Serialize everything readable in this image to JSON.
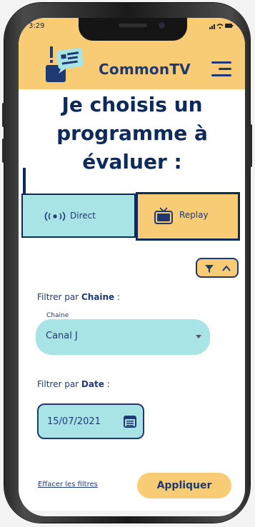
{
  "status": {
    "time": "3:29",
    "icons": "▐ ≡ ▬"
  },
  "header": {
    "brand": "CommonTV",
    "logo_icon": "speech-bubble-logo",
    "menu_icon": "hamburger-icon"
  },
  "title": {
    "line1": "Je choisis un",
    "line2": "programme à",
    "line3": "évaluer :"
  },
  "tabs": [
    {
      "label": "Direct",
      "icon": "broadcast-icon",
      "selected": false
    },
    {
      "label": "Replay",
      "icon": "tv-icon",
      "selected": true
    }
  ],
  "filters": {
    "toggle_icons": [
      "filter-icon",
      "chevron-up-icon"
    ],
    "channel": {
      "label_prefix": "Filtrer par ",
      "label_bold": "Chaine",
      "label_suffix": " :",
      "small_label": "Chaine",
      "value": "Canal J"
    },
    "date": {
      "label_prefix": "Filtrer par ",
      "label_bold": "Date",
      "label_suffix": " :",
      "value": "15/07/2021",
      "icon": "calendar-icon"
    }
  },
  "actions": {
    "clear": "Effacer les filtres",
    "apply": "Appliquer"
  },
  "colors": {
    "accent": "#f8cc74",
    "teal": "#a8e3e6",
    "navy": "#1f3a72"
  }
}
